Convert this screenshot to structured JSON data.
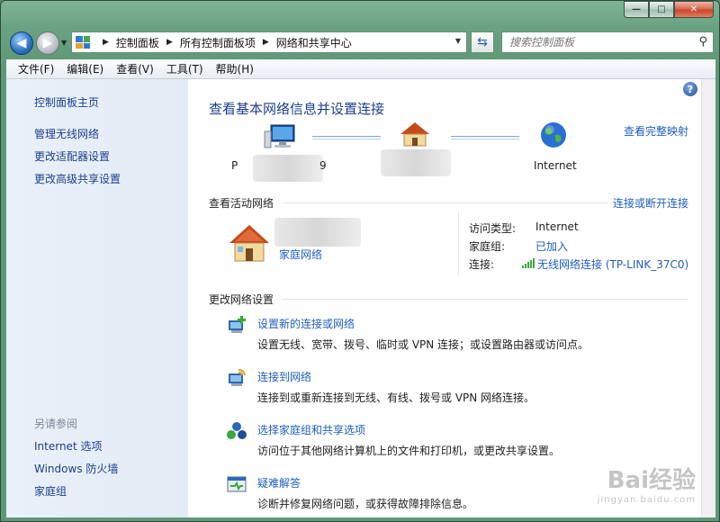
{
  "window": {
    "caption": {
      "minimize": "—",
      "maximize": "□",
      "close": "✕"
    }
  },
  "nav": {
    "breadcrumbs": [
      "控制面板",
      "所有控制面板项",
      "网络和共享中心"
    ],
    "search_placeholder": "搜索控制面板"
  },
  "menu": [
    "文件(F)",
    "编辑(E)",
    "查看(V)",
    "工具(T)",
    "帮助(H)"
  ],
  "sidebar": {
    "home": "控制面板主页",
    "links": [
      "管理无线网络",
      "更改适配器设置",
      "更改高级共享设置"
    ],
    "see_also_title": "另请参阅",
    "see_also": [
      "Internet 选项",
      "Windows 防火墙",
      "家庭组"
    ]
  },
  "main": {
    "title": "查看基本网络信息并设置连接",
    "full_map_link": "查看完整映射",
    "map": {
      "computer_label_start": "P",
      "computer_label_end": "9",
      "internet_label": "Internet"
    },
    "active_section": {
      "title": "查看活动网络",
      "connect_link": "连接或断开连接",
      "network_type": "家庭网络",
      "rows": [
        {
          "key": "访问类型:",
          "value": "Internet",
          "is_link": false
        },
        {
          "key": "家庭组:",
          "value": "已加入",
          "is_link": true
        },
        {
          "key": "连接:",
          "value": "无线网络连接 (TP-LINK_37C0)",
          "is_link": true
        }
      ]
    },
    "change_section": {
      "title": "更改网络设置",
      "tasks": [
        {
          "title": "设置新的连接或网络",
          "desc": "设置无线、宽带、拨号、临时或 VPN 连接；或设置路由器或访问点。"
        },
        {
          "title": "连接到网络",
          "desc": "连接到或重新连接到无线、有线、拨号或 VPN 网络连接。"
        },
        {
          "title": "选择家庭组和共享选项",
          "desc": "访问位于其他网络计算机上的文件和打印机，或更改共享设置。"
        },
        {
          "title": "疑难解答",
          "desc": "诊断并修复网络问题，或获得故障排除信息。"
        }
      ]
    }
  },
  "watermark": {
    "brand": "Bai经验",
    "url": "jingyan.baidu.com"
  },
  "colors": {
    "link": "#1f5fbf",
    "title": "#1e3e8c",
    "sidebar_bg": "#e9f0f9"
  }
}
